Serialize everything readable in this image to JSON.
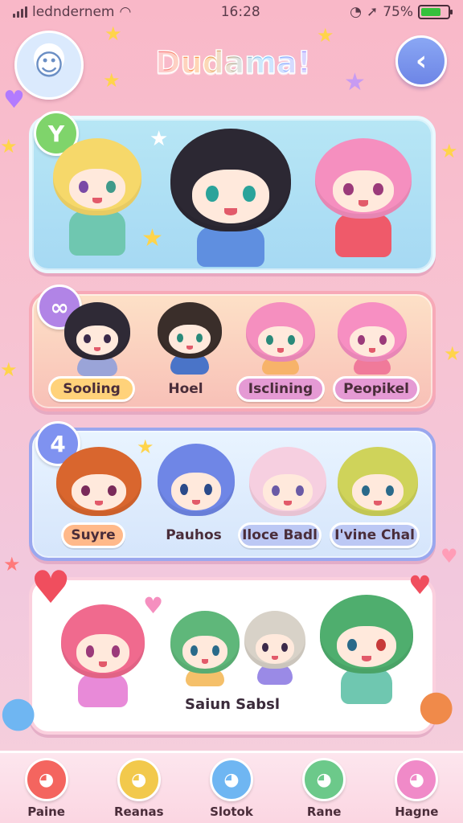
{
  "status_bar": {
    "carrier": "ledndernem",
    "time": "16:28",
    "battery": "75%",
    "battery_level": 0.75
  },
  "header": {
    "title": "Dudama!"
  },
  "panel_2": {
    "chips": [
      "Sooling",
      "Hoel",
      "Isclining",
      "Peopikel"
    ]
  },
  "panel_3": {
    "chips": [
      "Suyre",
      "Pauhos",
      "Iloce Badl",
      "I'vine Chal"
    ]
  },
  "panel_4": {
    "caption": "Saiun Sabsl"
  },
  "nav": {
    "items": [
      {
        "label": "Paine",
        "icon": "red-blob-icon",
        "color": "#f4655f"
      },
      {
        "label": "Reanas",
        "icon": "yellow-bear-icon",
        "color": "#f2c94c"
      },
      {
        "label": "Slotok",
        "icon": "blue-blob-icon",
        "color": "#6fb6f2"
      },
      {
        "label": "Rane",
        "icon": "green-bear-icon",
        "color": "#6cc98a"
      },
      {
        "label": "Hagne",
        "icon": "pink-blob-icon",
        "color": "#f08ac8"
      }
    ]
  },
  "colors": {
    "accent": "#f76fa4",
    "brand": "#7f92f0"
  }
}
